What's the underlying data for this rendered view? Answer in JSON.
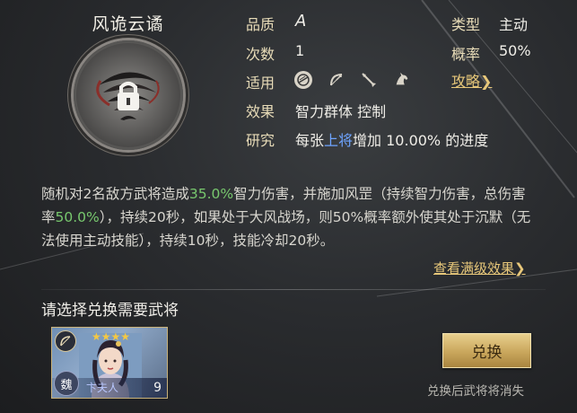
{
  "skill": {
    "title": "风诡云谲"
  },
  "info": {
    "quality_label": "品质",
    "quality_value": "A",
    "type_label": "类型",
    "type_value": "主动",
    "count_label": "次数",
    "count_value": "1",
    "rate_label": "概率",
    "rate_value": "50%",
    "applicable_label": "适用",
    "applicable_icons": [
      "shield-icon",
      "bow-icon",
      "spear-icon",
      "horse-icon"
    ],
    "strategy_link": "攻略",
    "effect_label": "效果",
    "effect_value": "智力群体 控制",
    "research_label": "研究",
    "research_prefix": "每张",
    "research_highlight": "上将",
    "research_suffix": "增加 10.00% 的进度"
  },
  "description": {
    "p1": "随机对2名敌方武将造成",
    "v1": "35.0%",
    "p2": "智力伤害，并施加风罡（持续智力伤害，总伤害率",
    "v2": "50.0%",
    "p3": "），持续20秒，如果处于大风战场，则50%概率额外使其处于沉默（无法使用主动技能），持续10秒，技能冷却20秒。"
  },
  "full_effect_link": "查看满级效果",
  "select_prompt": "请选择兑换需要武将",
  "general": {
    "name": "卞夫人",
    "level": "9",
    "faction": "魏",
    "stars": "★★★★"
  },
  "exchange_button": "兑换",
  "exchange_note": "兑换后武将将消失",
  "colors": {
    "accent_gold": "#e8c87a",
    "highlight_green": "#78c86e",
    "highlight_blue": "#6ea4ff"
  }
}
